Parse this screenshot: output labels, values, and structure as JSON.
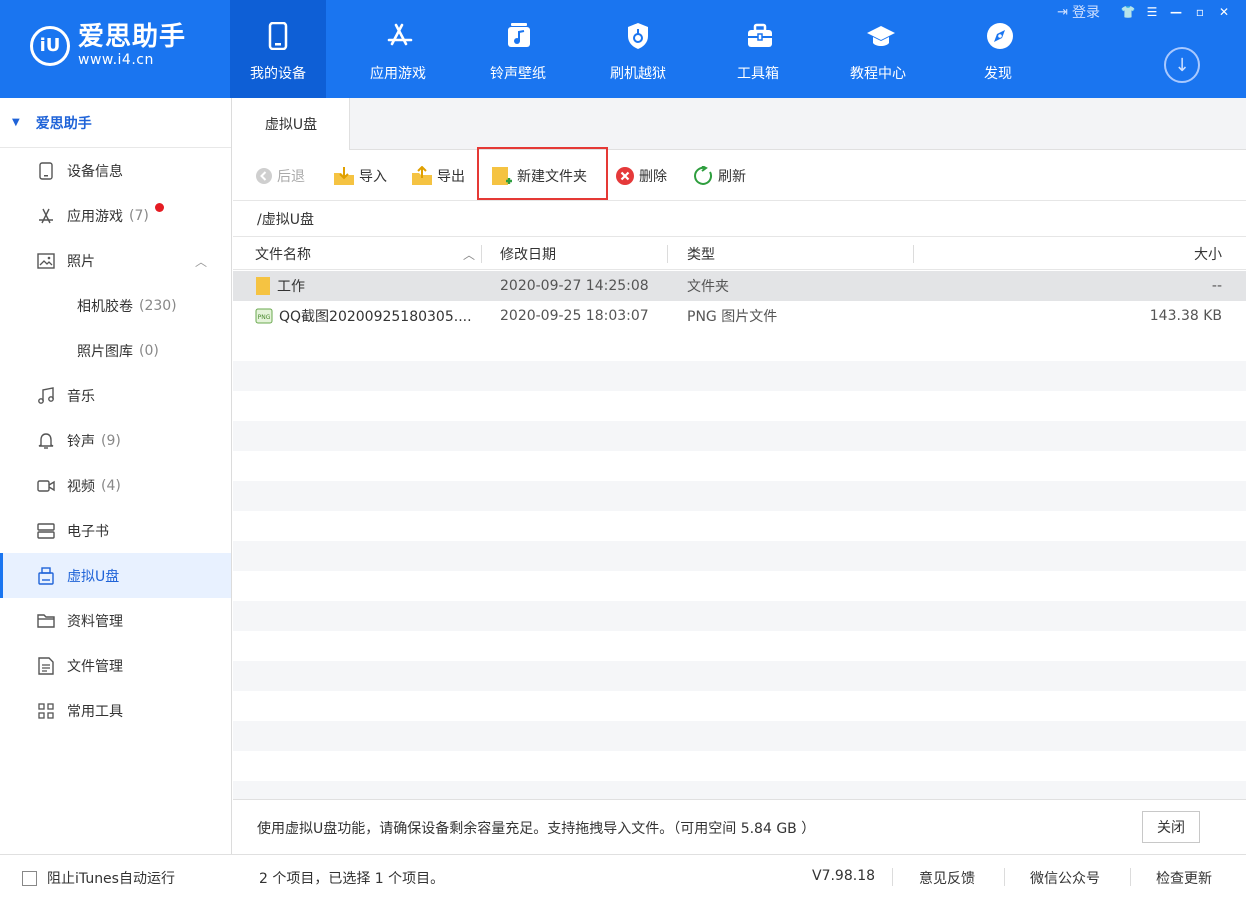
{
  "app": {
    "logo_mark": "iU",
    "name": "爱思助手",
    "url": "www.i4.cn"
  },
  "nav": [
    {
      "label": "我的设备",
      "icon": "phone-icon",
      "active": true
    },
    {
      "label": "应用游戏",
      "icon": "app-store-icon",
      "active": false
    },
    {
      "label": "铃声壁纸",
      "icon": "music-wallpaper-icon",
      "active": false
    },
    {
      "label": "刷机越狱",
      "icon": "shield-icon",
      "active": false
    },
    {
      "label": "工具箱",
      "icon": "toolbox-icon",
      "active": false
    },
    {
      "label": "教程中心",
      "icon": "graduation-cap-icon",
      "active": false
    },
    {
      "label": "发现",
      "icon": "compass-icon",
      "active": false
    }
  ],
  "window": {
    "login": "登录",
    "download_icon": "download-icon"
  },
  "sidebar": {
    "root": "爱思助手",
    "items": [
      {
        "label": "设备信息",
        "icon": "device-info-icon",
        "count": ""
      },
      {
        "label": "应用游戏",
        "icon": "app-icon",
        "count": "(7)"
      },
      {
        "label": "照片",
        "icon": "photo-icon",
        "count": ""
      },
      {
        "label": "相机胶卷",
        "icon": "",
        "count": "(230)"
      },
      {
        "label": "照片图库",
        "icon": "",
        "count": "(0)"
      },
      {
        "label": "音乐",
        "icon": "music-icon",
        "count": ""
      },
      {
        "label": "铃声",
        "icon": "bell-icon",
        "count": "(9)"
      },
      {
        "label": "视频",
        "icon": "video-icon",
        "count": "(4)"
      },
      {
        "label": "电子书",
        "icon": "book-icon",
        "count": ""
      },
      {
        "label": "虚拟U盘",
        "icon": "usb-drive-icon",
        "count": ""
      },
      {
        "label": "资料管理",
        "icon": "folder-icon",
        "count": ""
      },
      {
        "label": "文件管理",
        "icon": "file-icon",
        "count": ""
      },
      {
        "label": "常用工具",
        "icon": "grid-icon",
        "count": ""
      }
    ]
  },
  "tab": {
    "label": "虚拟U盘"
  },
  "toolbar": {
    "back": "后退",
    "import": "导入",
    "export": "导出",
    "new_folder": "新建文件夹",
    "delete": "删除",
    "refresh": "刷新"
  },
  "path": "/虚拟U盘",
  "table": {
    "columns": [
      "文件名称",
      "修改日期",
      "类型",
      "大小"
    ],
    "rows": [
      {
        "name": "工作",
        "date": "2020-09-27 14:25:08",
        "type": "文件夹",
        "size": "--",
        "icon": "folder-icon"
      },
      {
        "name": "QQ截图20200925180305....",
        "date": "2020-09-25 18:03:07",
        "type": "PNG 图片文件",
        "size": "143.38 KB",
        "icon": "png-file-icon"
      }
    ]
  },
  "info": {
    "text": "使用虚拟U盘功能，请确保设备剩余容量充足。支持拖拽导入文件。（可用空间 5.84 GB ）",
    "close": "关闭"
  },
  "status": {
    "itunes": "阻止iTunes自动运行",
    "selection": "2 个项目，已选择 1 个项目。",
    "version": "V7.98.18",
    "feedback": "意见反馈",
    "wechat": "微信公众号",
    "update": "检查更新"
  },
  "colors": {
    "brand": "#1a75f0",
    "highlight": "#e53935",
    "badge": "#e51c23"
  }
}
